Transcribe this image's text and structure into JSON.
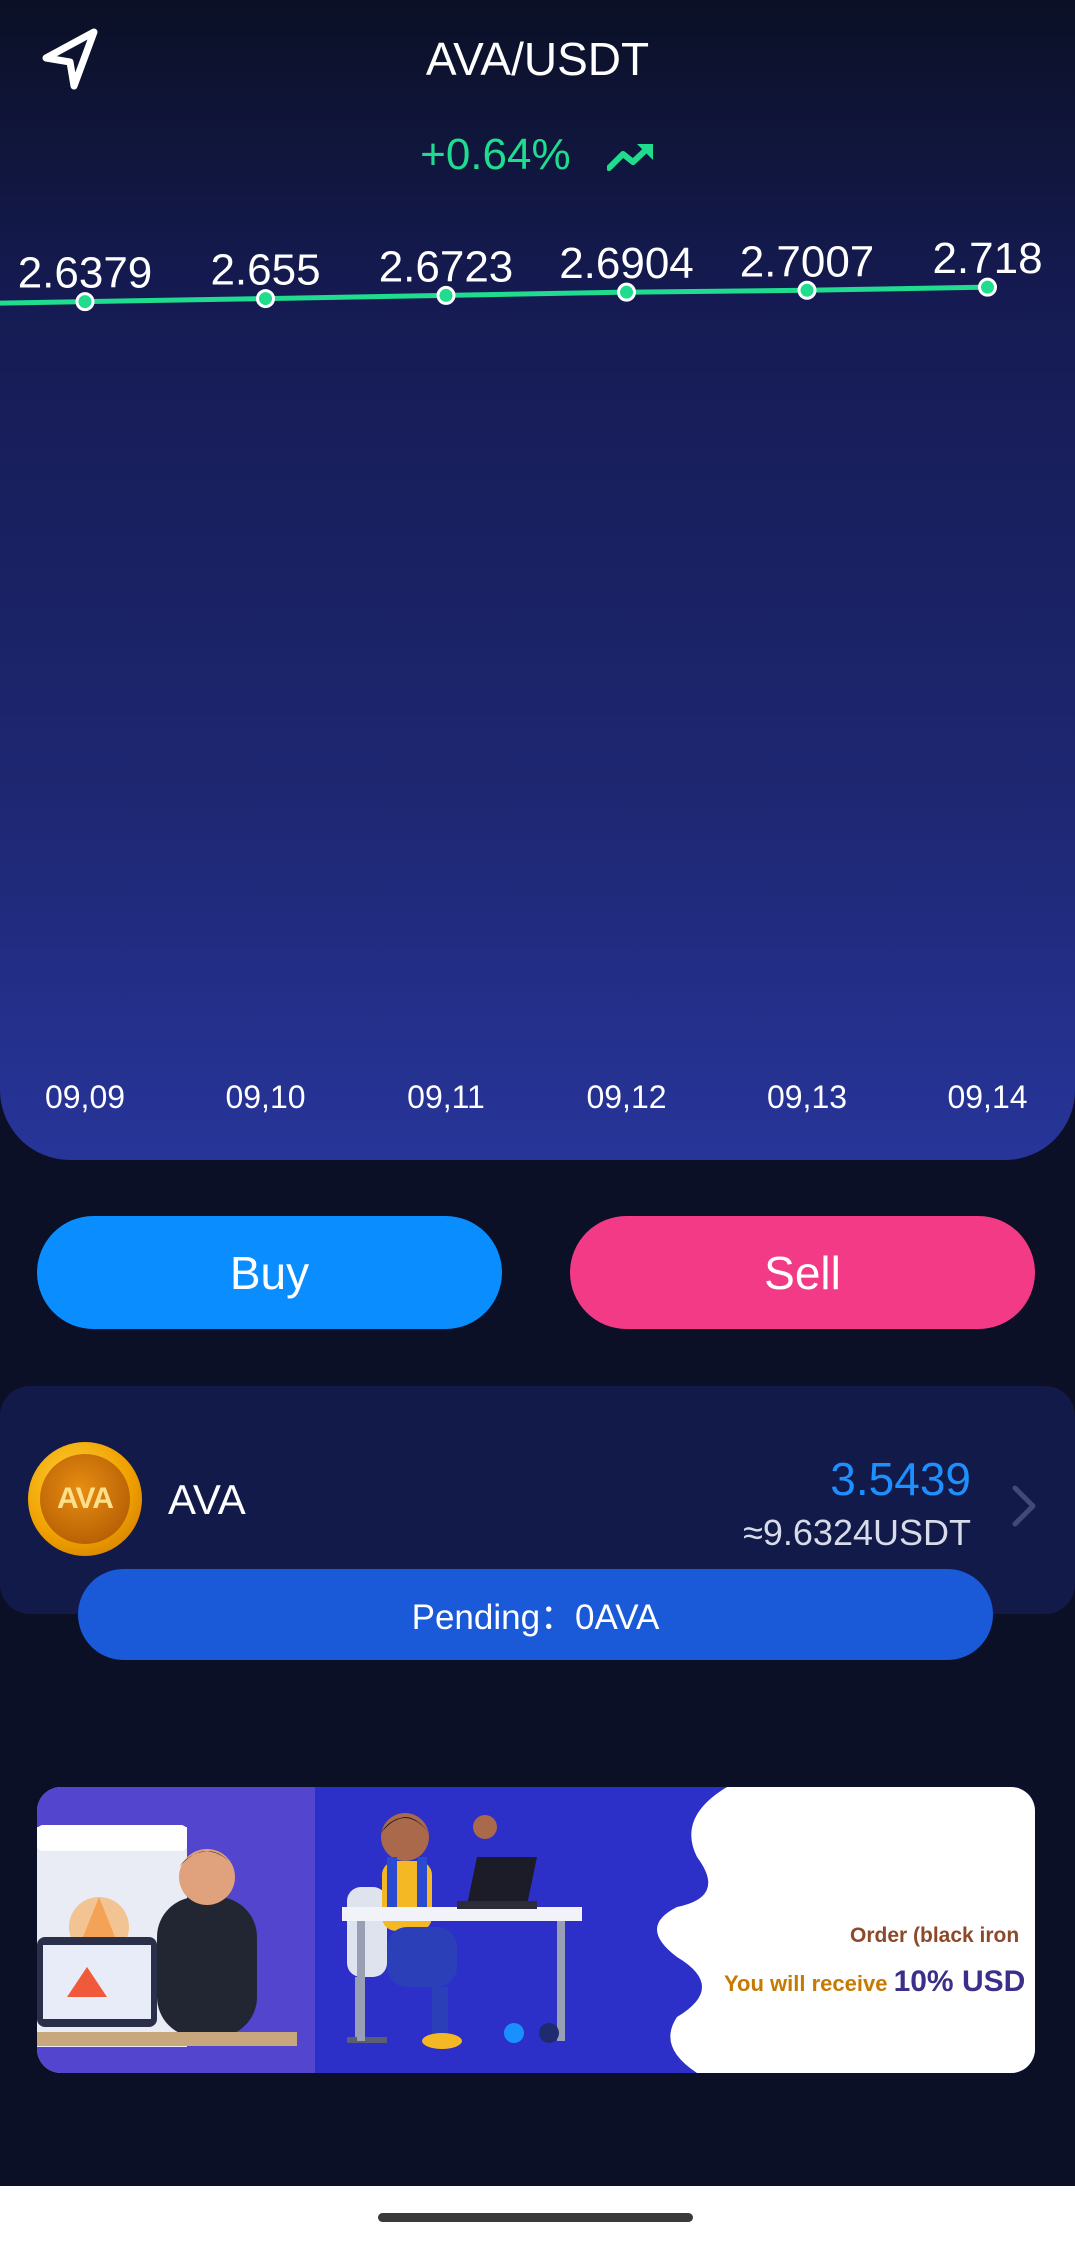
{
  "header": {
    "title": "AVA/USDT",
    "change": "+0.64%"
  },
  "chart_data": {
    "type": "line",
    "categories": [
      "09,09",
      "09,10",
      "09,11",
      "09,12",
      "09,13",
      "09,14"
    ],
    "values": [
      2.6379,
      2.655,
      2.6723,
      2.6904,
      2.7007,
      2.718
    ],
    "data_labels": [
      "2.6379",
      "2.655",
      "2.6723",
      "2.6904",
      "2.7007",
      "2.718"
    ],
    "title": "",
    "xlabel": "",
    "ylabel": "",
    "grid": false,
    "line_color": "#1fdc8f",
    "ylim": [
      -1.5,
      3.2
    ]
  },
  "actions": {
    "buy_label": "Buy",
    "sell_label": "Sell"
  },
  "asset": {
    "logo_text": "AVA",
    "name": "AVA",
    "amount": "3.5439",
    "usdt_value": "≈9.6324USDT",
    "pending": "Pending：0AVA"
  },
  "banner": {
    "line1": "Order (black iron",
    "line2_prefix": "You will receive ",
    "line2_highlight": "10% USD"
  },
  "colors": {
    "background": "#0b1026",
    "accent_green": "#1fdc8f",
    "buy": "#0a8dff",
    "sell": "#f23a86",
    "amount_blue": "#1e8fff",
    "pending_bar": "#1a5ad9"
  }
}
